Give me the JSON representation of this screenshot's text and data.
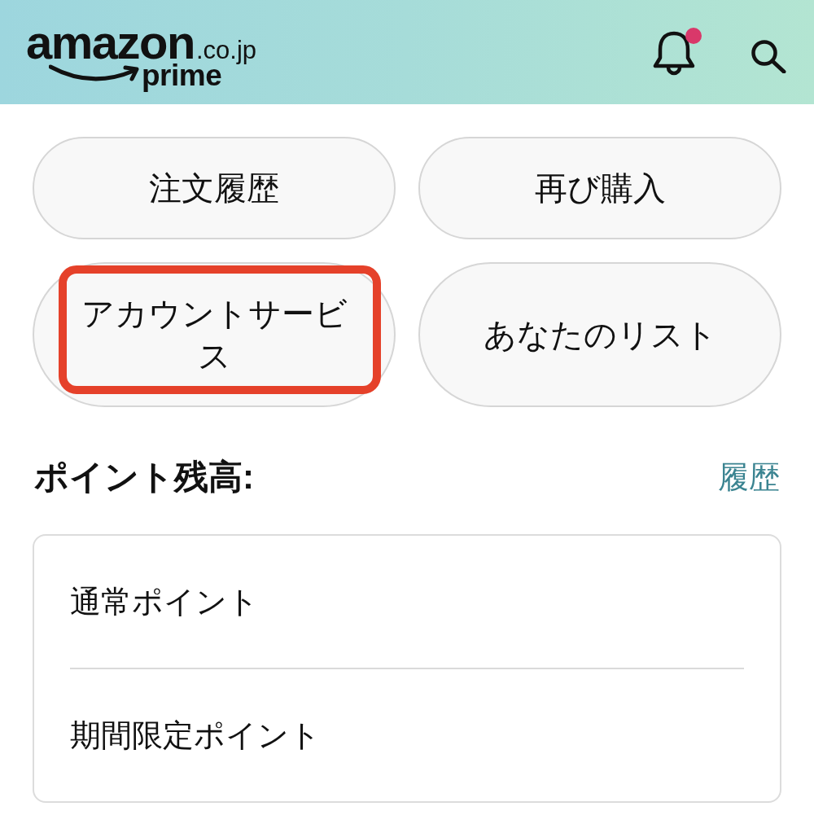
{
  "header": {
    "logo": {
      "wordmark": "amazon",
      "domain": ".co.jp",
      "tier": "prime"
    },
    "notifications": {
      "unread": true
    }
  },
  "buttons": [
    {
      "label": "注文履歴",
      "highlighted": false
    },
    {
      "label": "再び購入",
      "highlighted": false
    },
    {
      "label": "アカウントサービス",
      "highlighted": true
    },
    {
      "label": "あなたのリスト",
      "highlighted": false
    }
  ],
  "points": {
    "title": "ポイント残高:",
    "history_link": "履歴",
    "rows": [
      {
        "label": "通常ポイント"
      },
      {
        "label": "期間限定ポイント"
      }
    ]
  }
}
